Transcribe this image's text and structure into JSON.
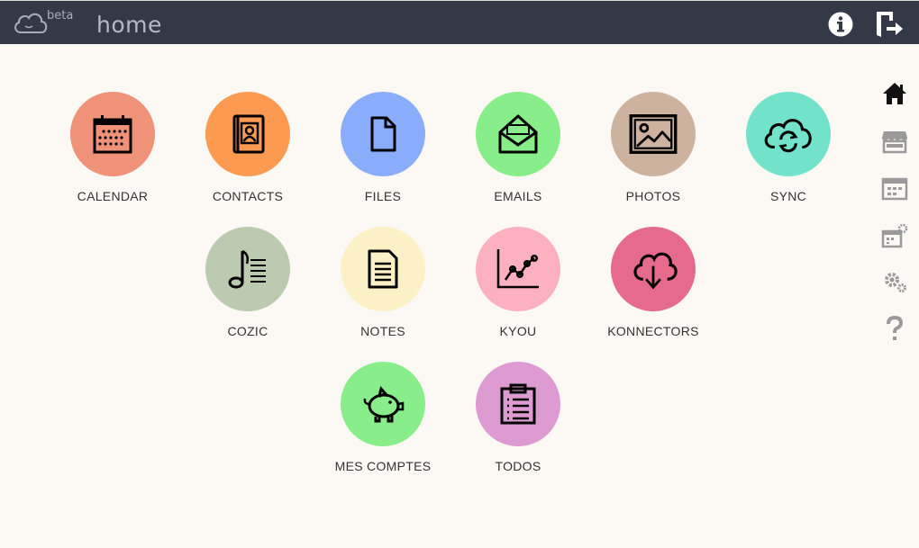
{
  "header": {
    "beta_label": "beta",
    "title": "home",
    "icons": {
      "logo": "cloud-logo-icon",
      "info": "info-icon",
      "logout": "logout-icon"
    }
  },
  "apps": [
    {
      "label": "CALENDAR",
      "color": "#ef9277",
      "icon": "calendar-icon"
    },
    {
      "label": "CONTACTS",
      "color": "#fd9a52",
      "icon": "contacts-icon"
    },
    {
      "label": "FILES",
      "color": "#8aadfb",
      "icon": "file-icon"
    },
    {
      "label": "EMAILS",
      "color": "#88ee8a",
      "icon": "mail-icon"
    },
    {
      "label": "PHOTOS",
      "color": "#cdb39f",
      "icon": "image-icon"
    },
    {
      "label": "SYNC",
      "color": "#73e2cb",
      "icon": "cloud-sync-icon"
    },
    {
      "label": "COZIC",
      "color": "#bccaaf",
      "icon": "music-icon"
    },
    {
      "label": "NOTES",
      "color": "#fcf0c6",
      "icon": "note-icon"
    },
    {
      "label": "KYOU",
      "color": "#fdb1c0",
      "icon": "chart-icon"
    },
    {
      "label": "KONNECTORS",
      "color": "#e56a8c",
      "icon": "cloud-download-icon"
    },
    {
      "label": "MES COMPTES",
      "color": "#88ee8a",
      "icon": "piggy-bank-icon"
    },
    {
      "label": "TODOS",
      "color": "#dd9bd1",
      "icon": "clipboard-icon"
    }
  ],
  "sidebar": [
    {
      "icon": "home-icon",
      "active": true
    },
    {
      "icon": "store-icon",
      "active": false
    },
    {
      "icon": "apps-grid-icon",
      "active": false
    },
    {
      "icon": "app-settings-icon",
      "active": false
    },
    {
      "icon": "settings-icon",
      "active": false
    },
    {
      "icon": "help-icon",
      "active": false
    }
  ],
  "colors": {
    "topbar": "#343947",
    "background": "#fcf8f3",
    "sidebar_active": "#111111",
    "sidebar_inactive": "#9a9a9a"
  }
}
